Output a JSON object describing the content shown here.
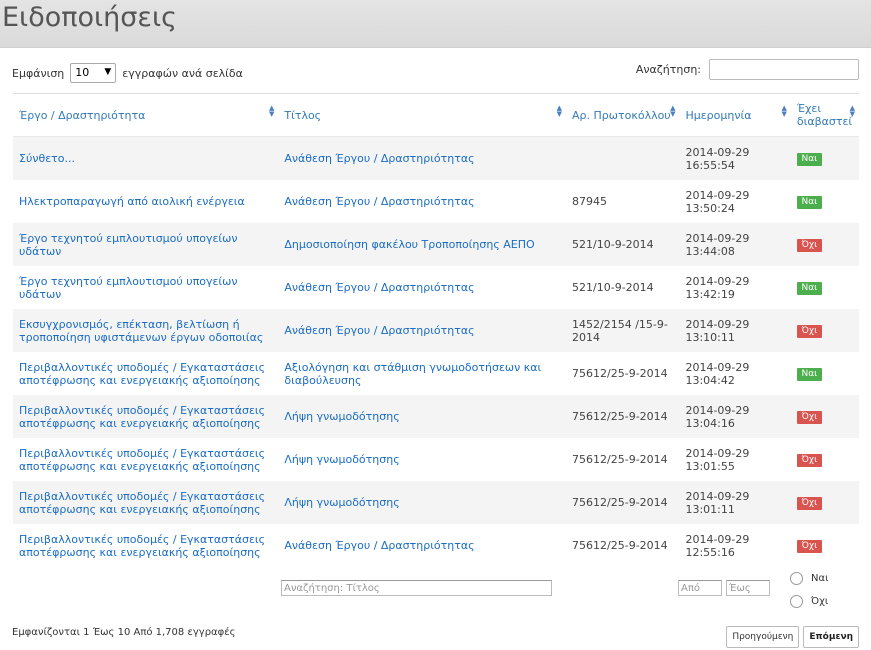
{
  "page": {
    "title": "Ειδοποιήσεις"
  },
  "length": {
    "prefix": "Εμφάνιση",
    "value": "10",
    "suffix": "εγγραφών ανά σελίδα"
  },
  "search": {
    "label": "Αναζήτηση:",
    "value": ""
  },
  "columns": [
    "Έργο / Δραστηριότητα",
    "Τίτλος",
    "Αρ. Πρωτοκόλλου",
    "Ημερομηνία",
    "Έχει διαβαστεί"
  ],
  "rows": [
    {
      "project": "Σύνθετο...",
      "title": "Ανάθεση Έργου / Δραστηριότητας",
      "protocol": "",
      "date": "2014-09-29",
      "time": "16:55:54",
      "read": "Ναι",
      "read_yes": true
    },
    {
      "project": "Ηλεκτροπαραγωγή από αιολική ενέργεια",
      "title": "Ανάθεση Έργου / Δραστηριότητας",
      "protocol": "87945",
      "date": "2014-09-29",
      "time": "13:50:24",
      "read": "Ναι",
      "read_yes": true
    },
    {
      "project": "Έργο τεχνητού εμπλουτισμού υπογείων υδάτων",
      "title": "Δημοσιοποίηση φακέλου Τροποποίησης ΑΕΠΟ",
      "protocol": "521/10-9-2014",
      "date": "2014-09-29",
      "time": "13:44:08",
      "read": "Όχι",
      "read_yes": false
    },
    {
      "project": "Έργο τεχνητού εμπλουτισμού υπογείων υδάτων",
      "title": "Ανάθεση Έργου / Δραστηριότητας",
      "protocol": "521/10-9-2014",
      "date": "2014-09-29",
      "time": "13:42:19",
      "read": "Ναι",
      "read_yes": true
    },
    {
      "project": "Εκσυγχρονισμός, επέκταση, βελτίωση ή τροποποίηση υφιστάμενων έργων οδοποιίας",
      "title": "Ανάθεση Έργου / Δραστηριότητας",
      "protocol": "1452/2154 /15-9-2014",
      "date": "2014-09-29",
      "time": "13:10:11",
      "read": "Όχι",
      "read_yes": false
    },
    {
      "project": "Περιβαλλοντικές υποδομές / Εγκαταστάσεις αποτέφρωσης και ενεργειακής αξιοποίησης",
      "title": "Αξιολόγηση και στάθμιση γνωμοδοτήσεων και διαβούλευσης",
      "protocol": "75612/25-9-2014",
      "date": "2014-09-29",
      "time": "13:04:42",
      "read": "Ναι",
      "read_yes": true
    },
    {
      "project": "Περιβαλλοντικές υποδομές / Εγκαταστάσεις αποτέφρωσης και ενεργειακής αξιοποίησης",
      "title": "Λήψη γνωμοδότησης",
      "protocol": "75612/25-9-2014",
      "date": "2014-09-29",
      "time": "13:04:16",
      "read": "Όχι",
      "read_yes": false
    },
    {
      "project": "Περιβαλλοντικές υποδομές / Εγκαταστάσεις αποτέφρωσης και ενεργειακής αξιοποίησης",
      "title": "Λήψη γνωμοδότησης",
      "protocol": "75612/25-9-2014",
      "date": "2014-09-29",
      "time": "13:01:55",
      "read": "Όχι",
      "read_yes": false
    },
    {
      "project": "Περιβαλλοντικές υποδομές / Εγκαταστάσεις αποτέφρωσης και ενεργειακής αξιοποίησης",
      "title": "Λήψη γνωμοδότησης",
      "protocol": "75612/25-9-2014",
      "date": "2014-09-29",
      "time": "13:01:11",
      "read": "Όχι",
      "read_yes": false
    },
    {
      "project": "Περιβαλλοντικές υποδομές / Εγκαταστάσεις αποτέφρωσης και ενεργειακής αξιοποίησης",
      "title": "Ανάθεση Έργου / Δραστηριότητας",
      "protocol": "75612/25-9-2014",
      "date": "2014-09-29",
      "time": "12:55:16",
      "read": "Όχι",
      "read_yes": false
    }
  ],
  "filters": {
    "title_placeholder": "Αναζήτηση: Τίτλος",
    "date_from_placeholder": "Από",
    "date_to_placeholder": "Έως",
    "radio_yes": "Ναι",
    "radio_no": "Όχι"
  },
  "footer": {
    "info": "Εμφανίζονται 1 Έως 10 Από 1,708 εγγραφές",
    "prev": "Προηγούμενη",
    "next": "Επόμενη"
  },
  "colors": {
    "link": "#1a6cc4",
    "yes": "#4cae4c",
    "no": "#d9534f"
  }
}
